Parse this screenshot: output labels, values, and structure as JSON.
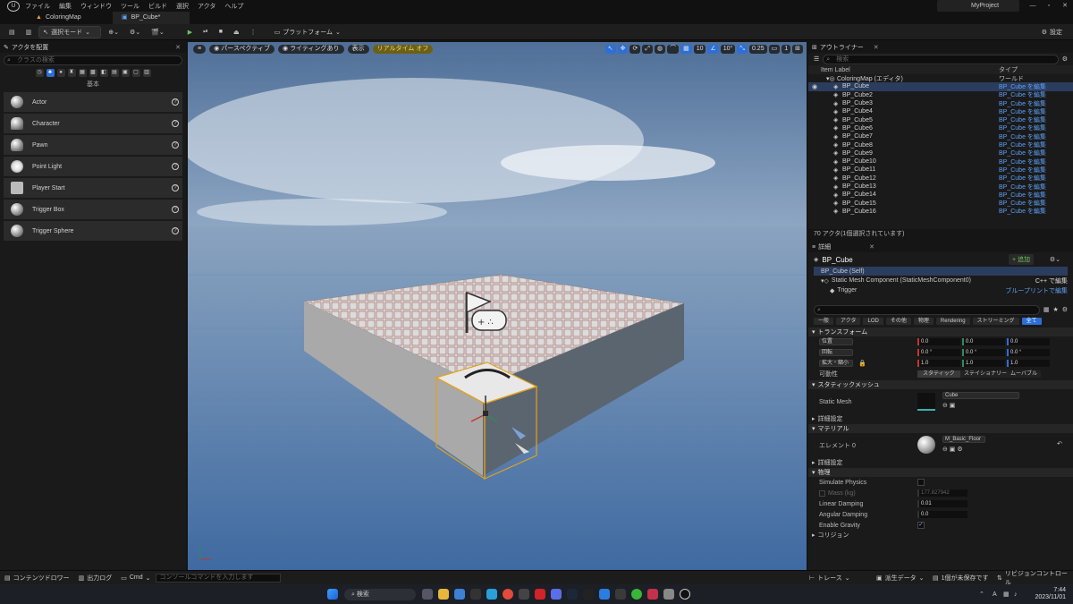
{
  "menubar": {
    "logo": "U",
    "items": [
      "ファイル",
      "編集",
      "ウィンドウ",
      "ツール",
      "ビルド",
      "選択",
      "アクタ",
      "ヘルプ"
    ],
    "project": "MyProject",
    "window_controls": [
      "—",
      "▫",
      "✕"
    ]
  },
  "tabs": [
    {
      "label": "ColoringMap",
      "icon": "map-icon"
    },
    {
      "label": "BP_Cube*",
      "icon": "blueprint-icon"
    }
  ],
  "toolbar": {
    "save": "💾",
    "mode_label": "選択モード",
    "platform_label": "プラットフォーム",
    "settings_label": "設定"
  },
  "place_actors": {
    "title": "アクタを配置",
    "search_placeholder": "クラスの検索",
    "category_label": "基本",
    "actors": [
      "Actor",
      "Character",
      "Pawn",
      "Point Light",
      "Player Start",
      "Trigger Box",
      "Trigger Sphere"
    ]
  },
  "viewport": {
    "perspective": "パースペクティブ",
    "lighting": "ライティングあり",
    "show": "表示",
    "realtime": "リアルタイム オフ",
    "grid": "10",
    "angle": "10°",
    "scale": "0.25",
    "camera": "1"
  },
  "outliner": {
    "title": "アウトライナー",
    "search_placeholder": "検索",
    "col_label": "Item Label",
    "col_type": "タイプ",
    "world_name": "ColoringMap (エディタ)",
    "world_type": "ワールド",
    "type_text": "BP_Cube を編集",
    "rows": [
      "BP_Cube",
      "BP_Cube2",
      "BP_Cube3",
      "BP_Cube4",
      "BP_Cube5",
      "BP_Cube6",
      "BP_Cube7",
      "BP_Cube8",
      "BP_Cube9",
      "BP_Cube10",
      "BP_Cube11",
      "BP_Cube12",
      "BP_Cube13",
      "BP_Cube14",
      "BP_Cube15",
      "BP_Cube16"
    ],
    "footer": "70 アクタ(1個選択されています)"
  },
  "details": {
    "title": "詳細",
    "object_name": "BP_Cube",
    "add_label": "+ 追加",
    "self_label": "BP_Cube (Self)",
    "component": "Static Mesh Component (StaticMeshComponent0)",
    "component_link": "C++ で編集",
    "trigger": "Trigger",
    "trigger_link": "ブループリントで編集",
    "filter_tabs": [
      "一般",
      "アクタ",
      "LOD",
      "その他",
      "物理",
      "Rendering",
      "ストリーミング",
      "全て"
    ],
    "transform_header": "トランスフォーム",
    "location_label": "位置",
    "rotation_label": "回転",
    "scale_label": "拡大・縮小",
    "location": [
      "0.0",
      "0.0",
      "0.0"
    ],
    "rotation": [
      "0.0 °",
      "0.0 °",
      "0.0 °"
    ],
    "scale": [
      "1.0",
      "1.0",
      "1.0"
    ],
    "mobility_label": "可動性",
    "mobility": [
      "スタティック",
      "ステイショナリー",
      "ムーバブル"
    ],
    "static_mesh_header": "スタティックメッシュ",
    "static_mesh_label": "Static Mesh",
    "mesh_value": "Cube",
    "advanced": "詳細設定",
    "material_header": "マテリアル",
    "element_label": "エレメント 0",
    "material_value": "M_Basic_Floor",
    "physics_header": "物理",
    "simulate": "Simulate Physics",
    "mass": "Mass (kg)",
    "mass_value": "177.827942",
    "linear": "Linear Damping",
    "linear_value": "0.01",
    "angular": "Angular Damping",
    "angular_value": "0.0",
    "gravity": "Enable Gravity",
    "collision": "コリジョン"
  },
  "bottombar": {
    "content_drawer": "コンテンツドロワー",
    "output_log": "出力ログ",
    "cmd": "Cmd",
    "console_placeholder": "コンソールコマンドを入力します",
    "trace": "トレース",
    "derived": "派生データ",
    "unsaved": "1個が未保存です",
    "revision": "リビジョンコントロール"
  },
  "taskbar": {
    "search": "検索",
    "time": "7:44",
    "date": "2023/11/01",
    "ime": "A"
  }
}
